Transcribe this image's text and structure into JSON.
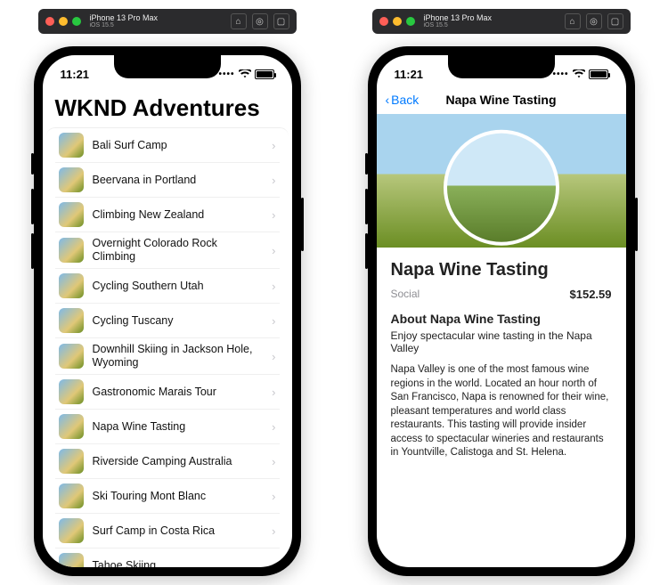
{
  "simulator": {
    "device": "iPhone 13 Pro Max",
    "os": "iOS 15.5"
  },
  "status": {
    "time": "11:21"
  },
  "screen1": {
    "title": "WKND Adventures",
    "items": [
      {
        "label": "Bali Surf Camp"
      },
      {
        "label": "Beervana in Portland"
      },
      {
        "label": "Climbing New Zealand"
      },
      {
        "label": "Overnight Colorado Rock Climbing"
      },
      {
        "label": "Cycling Southern Utah"
      },
      {
        "label": "Cycling Tuscany"
      },
      {
        "label": "Downhill Skiing in Jackson Hole, Wyoming"
      },
      {
        "label": "Gastronomic Marais Tour"
      },
      {
        "label": "Napa Wine Tasting"
      },
      {
        "label": "Riverside Camping Australia"
      },
      {
        "label": "Ski Touring Mont Blanc"
      },
      {
        "label": "Surf Camp in Costa Rica"
      },
      {
        "label": "Tahoe Skiing"
      }
    ]
  },
  "screen2": {
    "back": "Back",
    "navTitle": "Napa Wine Tasting",
    "title": "Napa Wine Tasting",
    "category": "Social",
    "price": "$152.59",
    "aboutHeading": "About Napa Wine Tasting",
    "tagline": "Enjoy spectacular wine tasting in the Napa Valley",
    "description": "Napa Valley is one of the most famous wine regions in the world. Located an hour north of San Francisco, Napa is renowned for their wine, pleasant temperatures and world class restaurants. This tasting will provide insider access to spectacular wineries and restaurants in Yountville, Calistoga and St. Helena."
  }
}
